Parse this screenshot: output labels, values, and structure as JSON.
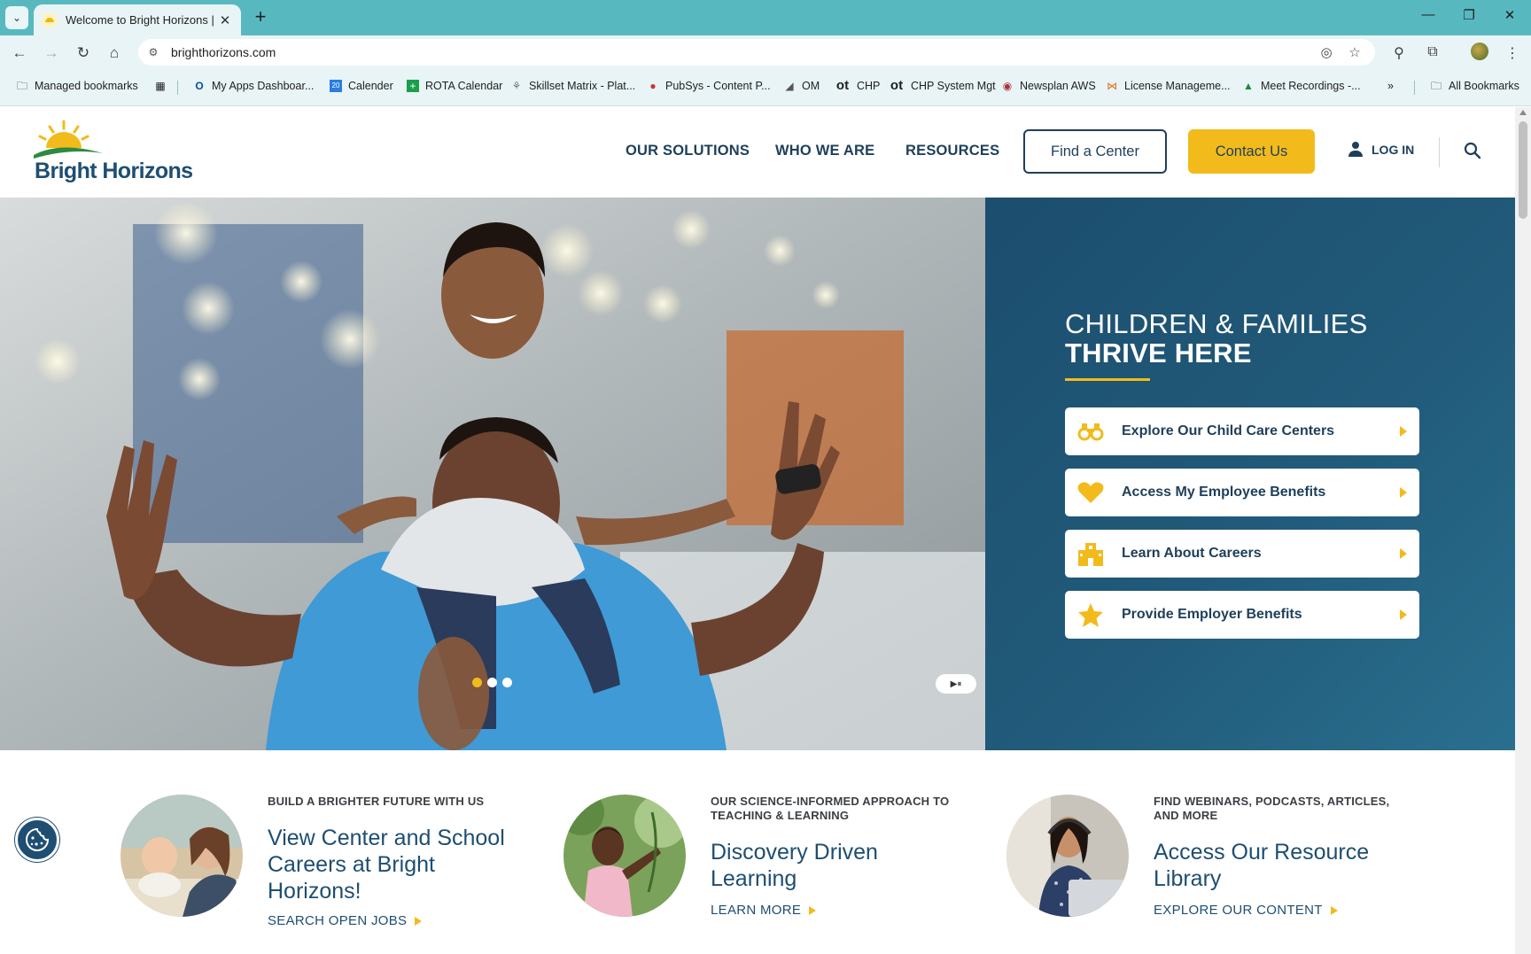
{
  "browser": {
    "tab_title": "Welcome to Bright Horizons | B",
    "url": "brighthorizons.com",
    "bookmarks": [
      {
        "label": "Managed bookmarks",
        "icon": "folder-icon"
      },
      {
        "label": "My Apps Dashboar...",
        "icon": "circle-o-icon"
      },
      {
        "label": "Calender",
        "icon": "calendar-icon"
      },
      {
        "label": "ROTA Calendar",
        "icon": "plus-green-icon"
      },
      {
        "label": "Skillset Matrix - Plat...",
        "icon": "matrix-icon"
      },
      {
        "label": "PubSys - Content P...",
        "icon": "pubsys-icon"
      },
      {
        "label": "OM",
        "icon": "om-icon"
      },
      {
        "label": "CHP",
        "icon": "ot-icon"
      },
      {
        "label": "CHP System Mgt",
        "icon": "ot-icon"
      },
      {
        "label": "Newsplan AWS",
        "icon": "newsplan-icon"
      },
      {
        "label": "License Manageme...",
        "icon": "license-icon"
      },
      {
        "label": "Meet Recordings -...",
        "icon": "drive-icon"
      }
    ],
    "ot_prefix": "ot",
    "all_bookmarks": "All Bookmarks"
  },
  "header": {
    "logo_text": "Bright Horizons",
    "logo_tm": ".",
    "nav": [
      "OUR SOLUTIONS",
      "WHO WE ARE",
      "RESOURCES"
    ],
    "find_center": "Find a Center",
    "contact": "Contact Us",
    "login": "LOG IN"
  },
  "hero": {
    "line1": "CHILDREN & FAMILIES",
    "line2": "THRIVE HERE",
    "ctas": [
      {
        "label": "Explore Our Child Care Centers",
        "icon": "binoculars-icon"
      },
      {
        "label": "Access My Employee Benefits",
        "icon": "heart-icon"
      },
      {
        "label": "Learn About Careers",
        "icon": "building-icon"
      },
      {
        "label": "Provide Employer Benefits",
        "icon": "star-icon"
      }
    ],
    "carousel_active_index": 0,
    "carousel_count": 3
  },
  "features": [
    {
      "eyebrow": "BUILD A BRIGHTER FUTURE WITH US",
      "title": "View Center and School Careers at Bright Horizons!",
      "link": "SEARCH OPEN JOBS"
    },
    {
      "eyebrow": "OUR SCIENCE-INFORMED APPROACH TO TEACHING & LEARNING",
      "title": "Discovery Driven Learning",
      "link": "LEARN MORE"
    },
    {
      "eyebrow": "FIND WEBINARS, PODCASTS, ARTICLES, AND MORE",
      "title": "Access Our Resource Library",
      "link": "EXPLORE OUR CONTENT"
    }
  ],
  "colors": {
    "accent": "#f2bb1b",
    "brand_navy": "#1e4e72",
    "tab_strip": "#58b8c0",
    "hero_panel": "#1c4e6e"
  }
}
